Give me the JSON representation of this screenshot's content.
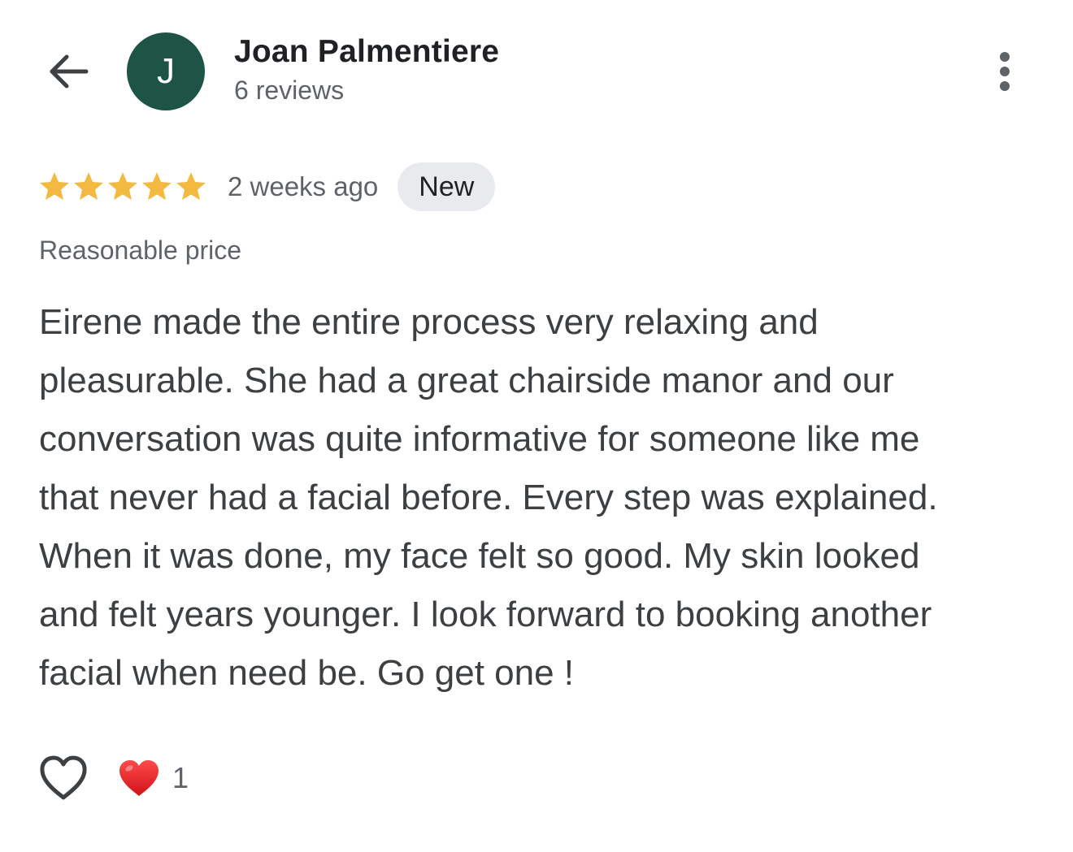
{
  "header": {
    "back_icon": "arrow-back-icon",
    "reviewer": {
      "avatar_initial": "J",
      "avatar_color": "#1e5445",
      "name": "Joan Palmentiere",
      "review_count": "6 reviews"
    },
    "more_icon": "more-vertical-icon"
  },
  "review": {
    "rating": 5,
    "rating_max": 5,
    "star_color": "#f4b940",
    "date": "2 weeks ago",
    "badge": "New",
    "attribute": "Reasonable price",
    "text_lines": [
      "Eirene made the entire process very relaxing and",
      "pleasurable. She had a great chairside manor and our",
      "conversation was quite informative for someone like me",
      "that never had a facial before. Every step was explained.",
      "When it was done, my face felt so good. My skin looked",
      "and felt years younger. I look forward to booking another",
      "facial when need be. Go get one !"
    ]
  },
  "footer": {
    "like_icon": "heart-outline-icon",
    "reaction_icon": "red-heart-icon",
    "reaction_count": "1"
  }
}
